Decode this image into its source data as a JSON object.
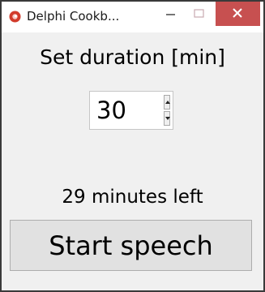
{
  "window": {
    "title": "Delphi Cookb...",
    "close_color": "#c75050",
    "app_icon": "delphi-app-icon"
  },
  "form": {
    "duration_label": "Set duration [min]",
    "duration_value": "30",
    "status_text": "29 minutes left",
    "start_button_label": "Start speech"
  }
}
